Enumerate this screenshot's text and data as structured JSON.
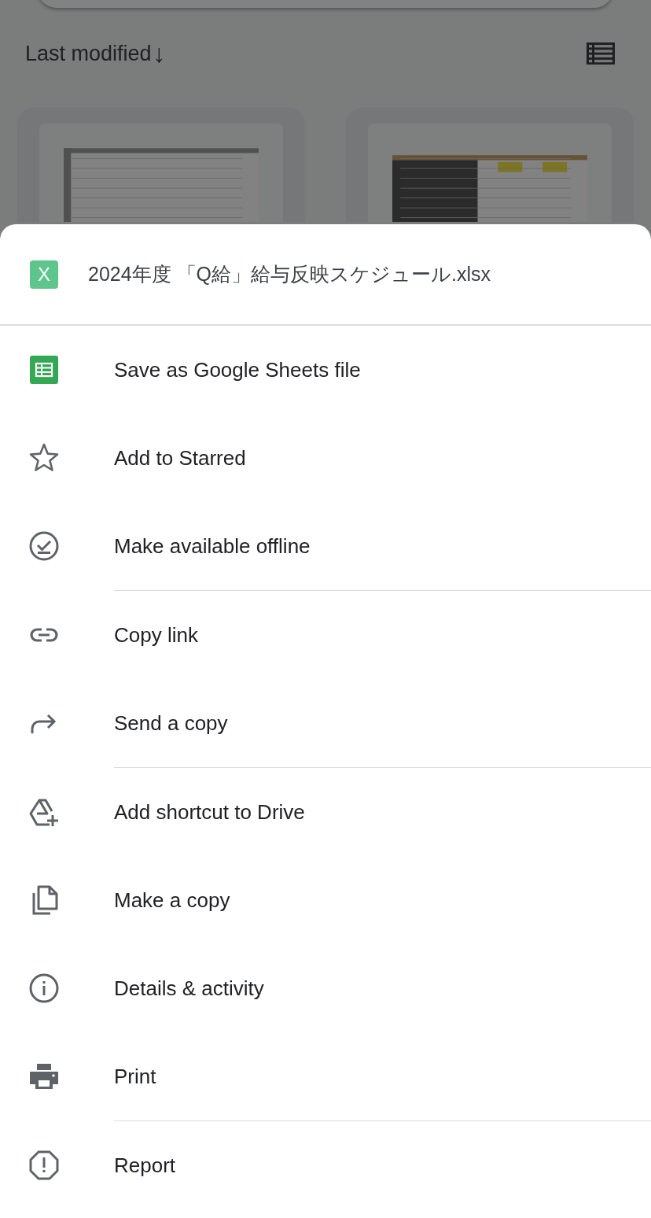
{
  "background": {
    "sort": {
      "label": "Last modified",
      "arrow": "↓"
    }
  },
  "sheet": {
    "file": {
      "icon_letter": "X",
      "name": "2024年度 「Q給」給与反映スケジュール.xlsx"
    },
    "items": [
      {
        "kind": "sheets",
        "label": "Save as Google Sheets file",
        "divider_after": false
      },
      {
        "kind": "star",
        "label": "Add to Starred",
        "divider_after": false
      },
      {
        "kind": "offline",
        "label": "Make available offline",
        "divider_after": true
      },
      {
        "kind": "link",
        "label": "Copy link",
        "divider_after": false
      },
      {
        "kind": "share",
        "label": "Send a copy",
        "divider_after": true
      },
      {
        "kind": "shortcut",
        "label": "Add shortcut to Drive",
        "divider_after": false
      },
      {
        "kind": "copy",
        "label": "Make a copy",
        "divider_after": false
      },
      {
        "kind": "info",
        "label": "Details & activity",
        "divider_after": false
      },
      {
        "kind": "print",
        "label": "Print",
        "divider_after": true
      },
      {
        "kind": "report",
        "label": "Report",
        "divider_after": false
      }
    ]
  }
}
